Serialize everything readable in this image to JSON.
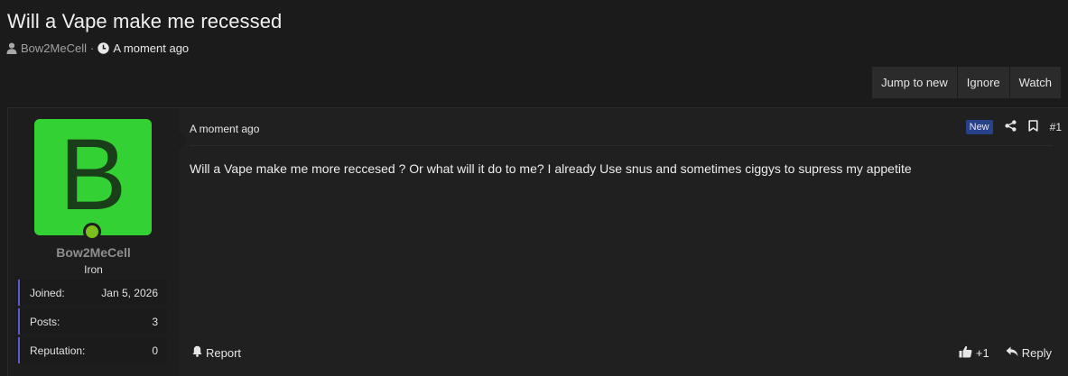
{
  "thread": {
    "title": "Will a Vape make me recessed",
    "author": "Bow2MeCell",
    "separator": "·",
    "time": "A moment ago"
  },
  "actions": {
    "jump_to_new": "Jump to new",
    "ignore": "Ignore",
    "watch": "Watch"
  },
  "user": {
    "avatar_letter": "B",
    "avatar_color": "#33d133",
    "name": "Bow2MeCell",
    "title": "Iron",
    "online": true,
    "stats": [
      {
        "label": "Joined:",
        "value": "Jan 5, 2026"
      },
      {
        "label": "Posts:",
        "value": "3"
      },
      {
        "label": "Reputation:",
        "value": "0"
      }
    ]
  },
  "post": {
    "date": "A moment ago",
    "badge": "New",
    "number": "#1",
    "body": "Will a Vape make me more reccesed ? Or what will it do to me? I already Use snus and sometimes ciggys to supress my appetite",
    "report_label": "Report",
    "reaction_count": "+1",
    "reply_label": "Reply"
  },
  "icons": {
    "author": "user-icon",
    "time": "clock-icon",
    "share": "share-icon",
    "bookmark": "bookmark-icon",
    "report": "bell-icon",
    "like": "thumbs-up-icon",
    "reply": "reply-icon"
  },
  "colors": {
    "background": "#1b1b1b",
    "badge": "#27418a",
    "stat_accent": "#5b5bcf",
    "online": "#7cbf1d"
  }
}
